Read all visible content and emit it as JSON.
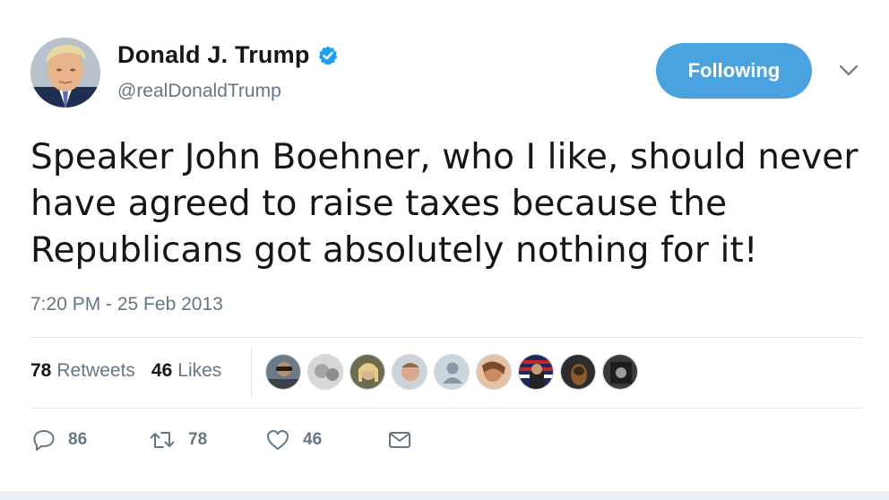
{
  "user": {
    "display_name": "Donald J. Trump",
    "handle": "@realDonaldTrump",
    "verified": true,
    "verified_color": "#1da1f2"
  },
  "follow_button": {
    "label": "Following",
    "color": "#4aa3df"
  },
  "menu_icon": "chevron-down-icon",
  "tweet": {
    "text": "Speaker John Boehner, who I like, should never have agreed to raise taxes because the Republicans got absolutely nothing for it!",
    "timestamp": "7:20 PM - 25 Feb 2013"
  },
  "stats": {
    "retweets_count": "78",
    "retweets_label": "Retweets",
    "likes_count": "46",
    "likes_label": "Likes"
  },
  "liked_by_avatars": [
    {
      "icon": "avatar-1"
    },
    {
      "icon": "avatar-2"
    },
    {
      "icon": "avatar-3"
    },
    {
      "icon": "avatar-4"
    },
    {
      "icon": "avatar-default"
    },
    {
      "icon": "avatar-6"
    },
    {
      "icon": "avatar-7"
    },
    {
      "icon": "avatar-8"
    },
    {
      "icon": "avatar-9"
    }
  ],
  "actions": {
    "reply_count": "86",
    "retweet_count": "78",
    "like_count": "46",
    "icons": [
      "reply-icon",
      "retweet-icon",
      "like-icon",
      "message-icon"
    ]
  },
  "colors": {
    "secondary_text": "#657786",
    "divider": "#e1e8ed"
  }
}
